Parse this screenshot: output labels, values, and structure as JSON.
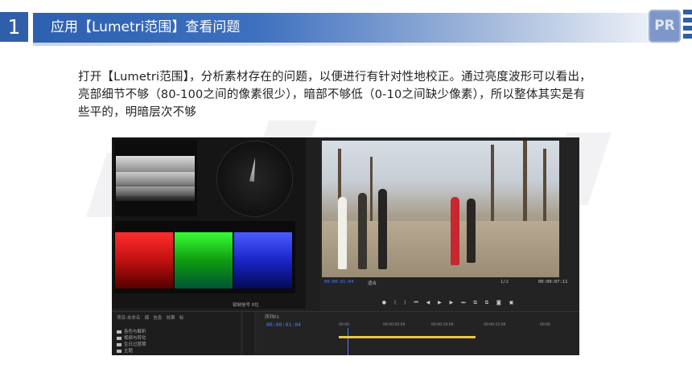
{
  "header": {
    "number": "1",
    "title": "应用【Lumetri范围】查看问题",
    "logo_text": "PR"
  },
  "paragraph": "打开【Lumetri范围】，分析素材存在的问题，以便进行有针对性地校正。通过亮度波形可以看出，亮部细节不够（80-100之间的像素很少），暗部不够低（0-10之间缺少像素），所以整体其实是有些平的，明暗层次不够",
  "screenshot": {
    "program_timecode_left": "00:00:01:04",
    "program_fit": "适合",
    "program_fraction": "1/2",
    "program_timecode_right": "00:00:07:11",
    "scope_toolbar": "钳制信号  8位",
    "project_tabs": [
      "项目:未命名",
      "媒",
      "信息",
      "效果",
      "标"
    ],
    "folders": [
      "各色与解析",
      "视频与转化",
      "生日过度期",
      "主题"
    ],
    "timeline": {
      "tab": "序列01",
      "timecode": "00:00:01:04",
      "ruler": [
        "00:00",
        "00:00:05:00",
        "00:00:10:00",
        "00:00:15:00",
        "00:00"
      ]
    }
  }
}
